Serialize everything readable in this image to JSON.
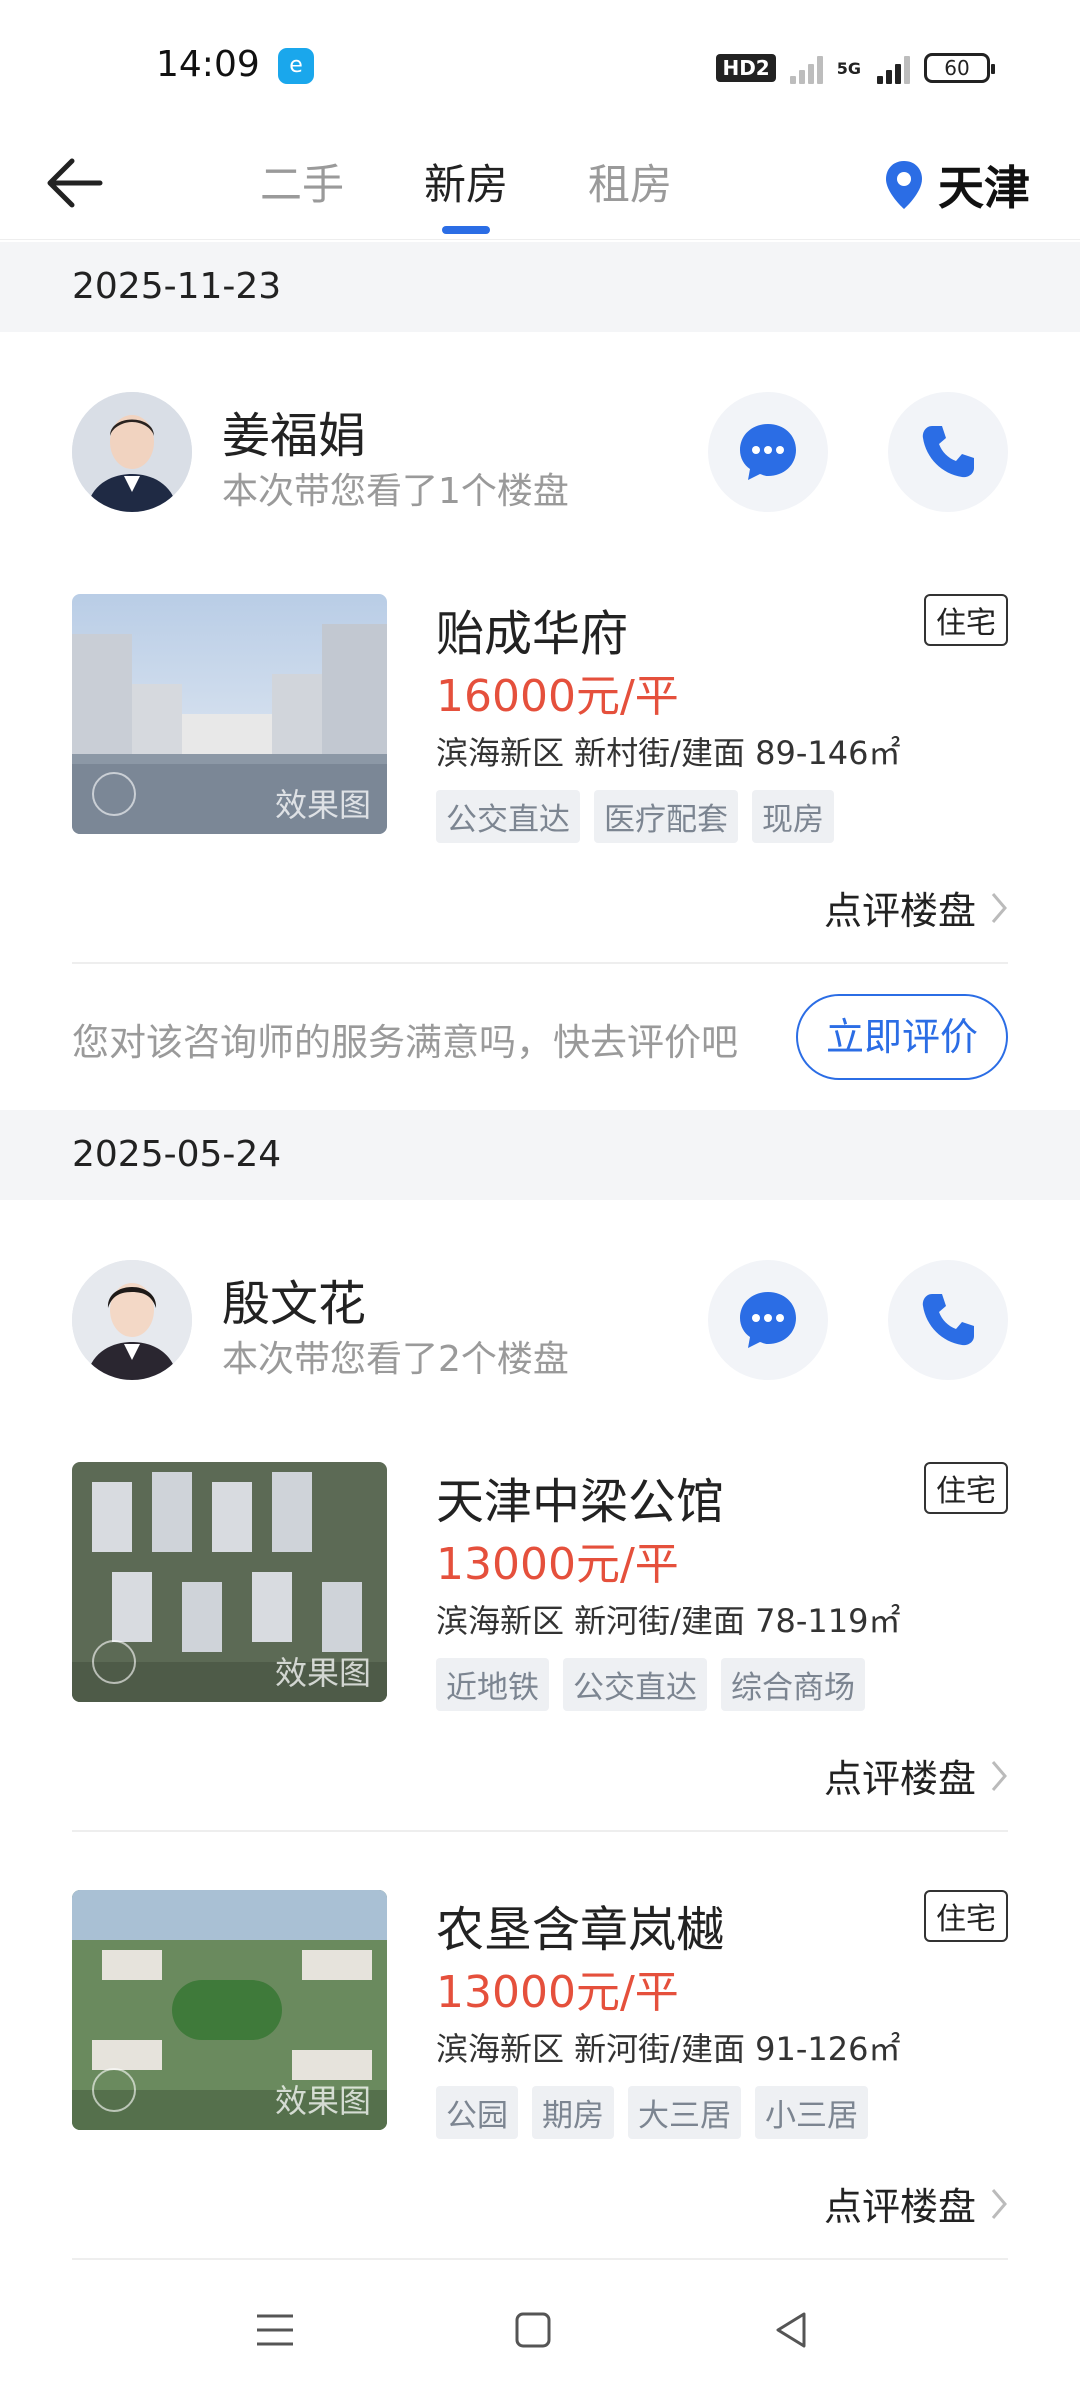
{
  "status": {
    "time": "14:09",
    "app_icon": "e",
    "hd": "HD2",
    "net": "5G",
    "battery": "60"
  },
  "header": {
    "tabs": [
      "二手",
      "新房",
      "租房"
    ],
    "active_tab": 1,
    "city": "天津"
  },
  "visits": [
    {
      "date": "2025-11-23",
      "agent": {
        "name": "姜福娟",
        "subtitle": "本次带您看了1个楼盘"
      },
      "properties": [
        {
          "name": "贻成华府",
          "type": "住宅",
          "price": "16000元/平",
          "location": "滨海新区 新村街/建面 89-146㎡",
          "tags": [
            "公交直达",
            "医疗配套",
            "现房"
          ],
          "watermark": "效果图",
          "review": "点评楼盘"
        }
      ],
      "satisfaction": "您对该咨询师的服务满意吗，快去评价吧",
      "rate_button": "立即评价"
    },
    {
      "date": "2025-05-24",
      "agent": {
        "name": "殷文花",
        "subtitle": "本次带您看了2个楼盘"
      },
      "properties": [
        {
          "name": "天津中梁公馆",
          "type": "住宅",
          "price": "13000元/平",
          "location": "滨海新区 新河街/建面 78-119㎡",
          "tags": [
            "近地铁",
            "公交直达",
            "综合商场"
          ],
          "watermark": "效果图",
          "review": "点评楼盘"
        },
        {
          "name": "农垦含章岚樾",
          "type": "住宅",
          "price": "13000元/平",
          "location": "滨海新区 新河街/建面 91-126㎡",
          "tags": [
            "公园",
            "期房",
            "大三居",
            "小三居"
          ],
          "watermark": "效果图",
          "review": "点评楼盘"
        }
      ]
    }
  ],
  "colors": {
    "accent": "#2b6de5",
    "price": "#e5503c",
    "band": "#f4f5f7"
  }
}
